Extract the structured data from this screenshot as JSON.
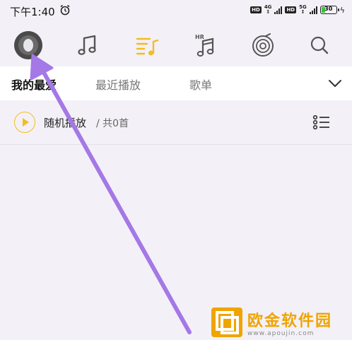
{
  "status_bar": {
    "time": "下午1:40",
    "hd_1": "HD",
    "net_1": "4G",
    "hd_2": "HD",
    "net_2": "5G",
    "battery": "30",
    "battery_level": 0.3
  },
  "nav": {
    "icons": [
      "avatar",
      "music-note-icon",
      "playlist-icon",
      "hr-music-icon",
      "radio-icon",
      "search-icon"
    ],
    "active_color": "#f3bd1f"
  },
  "tabs": {
    "items": [
      {
        "label": "我的最爱",
        "active": true
      },
      {
        "label": "最近播放",
        "active": false
      },
      {
        "label": "歌单",
        "active": false
      }
    ]
  },
  "shuffle": {
    "label": "随机播放",
    "separator": "/",
    "count": "共0首"
  },
  "watermark": {
    "title": "欧金软件园",
    "url": "www.apoujin.com"
  },
  "colors": {
    "accent": "#f3bd1f",
    "arrow": "#a478e6",
    "background": "#f3f1f7"
  }
}
